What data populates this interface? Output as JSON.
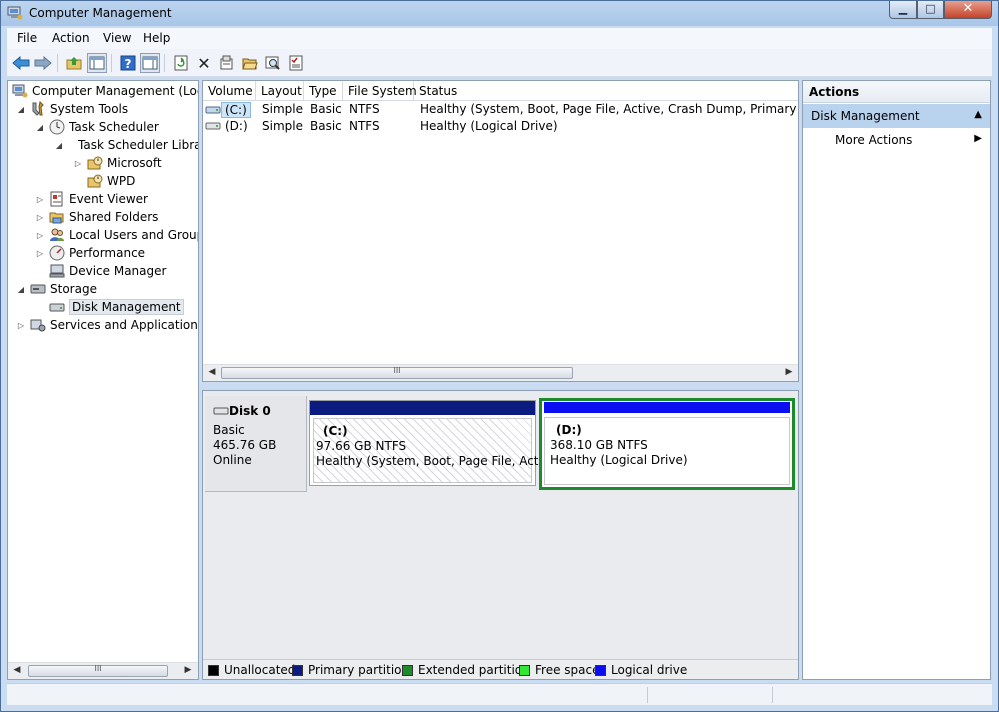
{
  "window": {
    "title": "Computer Management"
  },
  "menu": [
    "File",
    "Action",
    "View",
    "Help"
  ],
  "tree": {
    "items": [
      {
        "label": "Computer Management (Local",
        "icon": "computer-management-icon"
      },
      {
        "label": "System Tools",
        "icon": "system-tools-icon"
      },
      {
        "label": "Task Scheduler",
        "icon": "clock-icon"
      },
      {
        "label": "Task Scheduler Libra",
        "icon": "folder-icon"
      },
      {
        "label": "Microsoft",
        "icon": "folder-clock-icon"
      },
      {
        "label": "WPD",
        "icon": "folder-clock-icon"
      },
      {
        "label": "Event Viewer",
        "icon": "event-viewer-icon"
      },
      {
        "label": "Shared Folders",
        "icon": "shared-folder-icon"
      },
      {
        "label": "Local Users and Groups",
        "icon": "users-icon"
      },
      {
        "label": "Performance",
        "icon": "performance-icon"
      },
      {
        "label": "Device Manager",
        "icon": "device-manager-icon"
      },
      {
        "label": "Storage",
        "icon": "storage-icon"
      },
      {
        "label": "Disk Management",
        "icon": "disk-icon"
      },
      {
        "label": "Services and Applications",
        "icon": "services-icon"
      }
    ]
  },
  "volumes": {
    "columns": [
      "Volume",
      "Layout",
      "Type",
      "File System",
      "Status"
    ],
    "rows": [
      {
        "volume": "(C:)",
        "layout": "Simple",
        "type": "Basic",
        "fs": "NTFS",
        "status": "Healthy (System, Boot, Page File, Active, Crash Dump, Primary Partition"
      },
      {
        "volume": "(D:)",
        "layout": "Simple",
        "type": "Basic",
        "fs": "NTFS",
        "status": "Healthy (Logical Drive)"
      }
    ]
  },
  "disk": {
    "name": "Disk 0",
    "type": "Basic",
    "size": "465.76 GB",
    "state": "Online",
    "partitions": [
      {
        "label": "(C:)",
        "size": "97.66 GB NTFS",
        "status": "Healthy (System, Boot, Page File, Active,"
      },
      {
        "label": "(D:)",
        "size": "368.10 GB NTFS",
        "status": "Healthy (Logical Drive)"
      }
    ]
  },
  "legend": [
    {
      "label": "Unallocated",
      "color": "#000000"
    },
    {
      "label": "Primary partition",
      "color": "#0b1b80"
    },
    {
      "label": "Extended partition",
      "color": "#1d8a2b"
    },
    {
      "label": "Free space",
      "color": "#33e633"
    },
    {
      "label": "Logical drive",
      "color": "#0a0ef0"
    }
  ],
  "actions": {
    "title": "Actions",
    "group": "Disk Management",
    "more": "More Actions"
  },
  "scrollbar_grip": "III"
}
